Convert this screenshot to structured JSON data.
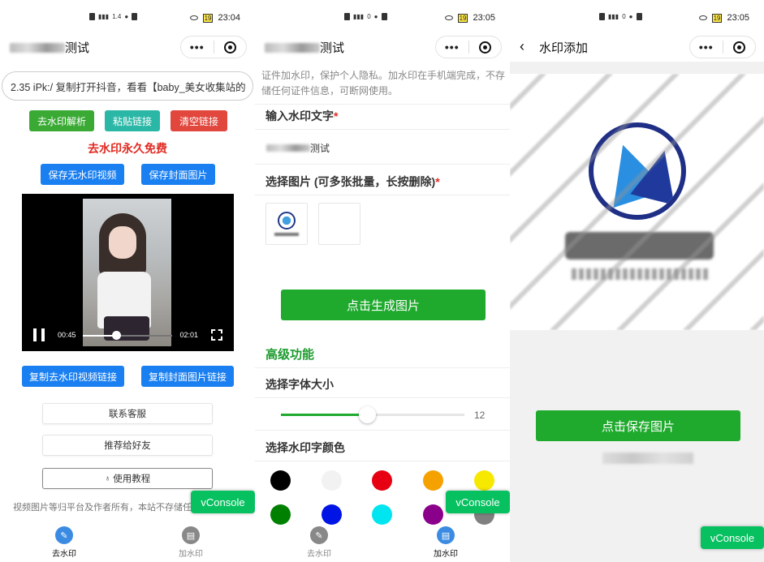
{
  "screens": [
    {
      "status": {
        "time": "23:04",
        "speed": "1.4",
        "battery": "19"
      },
      "nav": {
        "title_suffix": "测试"
      },
      "url_text": "2.35 iPk:/ 复制打开抖音，看看【baby_美女收集站的",
      "buttons": {
        "remove_wm": "去水印解析",
        "paste": "粘贴链接",
        "clear": "清空链接"
      },
      "free_text": "去水印永久免费",
      "save_video": "保存无水印视频",
      "save_cover": "保存封面图片",
      "video": {
        "current": "00:45",
        "duration": "02:01",
        "progress": 0.37
      },
      "copy_video_link": "复制去水印视频链接",
      "copy_cover_link": "复制封面图片链接",
      "contact": "联系客服",
      "recommend": "推荐给好友",
      "tutorial": "使用教程",
      "disclaimer": "视频图片等归平台及作者所有，本站不存储任何",
      "vconsole": "vConsole",
      "tabs": [
        {
          "label": "去水印",
          "active": true
        },
        {
          "label": "加水印",
          "active": false
        }
      ]
    },
    {
      "status": {
        "time": "23:05",
        "speed": "0",
        "battery": "19"
      },
      "nav": {
        "title_suffix": "测试"
      },
      "intro": "证件加水印，保护个人隐私。加水印在手机端完成，不存储任何证件信息，可断网使用。",
      "input_label": "输入水印文字",
      "input_value_suffix": "测试",
      "image_label": "选择图片 (可多张批量，长按删除)",
      "generate_button": "点击生成图片",
      "advanced": "高级功能",
      "font_size_label": "选择字体大小",
      "font_size": {
        "value": "12",
        "fraction": 0.47
      },
      "color_label": "选择水印字颜色",
      "colors": [
        "#000000",
        "#f2f2f2",
        "#e60012",
        "#f5a100",
        "#f7e800",
        "#008000",
        "#0014e6",
        "#00e5f0",
        "#8a008a",
        "#808080"
      ],
      "vconsole": "vConsole",
      "tabs": [
        {
          "label": "去水印",
          "active": false
        },
        {
          "label": "加水印",
          "active": true
        }
      ]
    },
    {
      "status": {
        "time": "23:05",
        "speed": "0",
        "battery": "19"
      },
      "nav": {
        "title": "水印添加"
      },
      "save_button": "点击保存图片",
      "vconsole": "vConsole"
    }
  ]
}
